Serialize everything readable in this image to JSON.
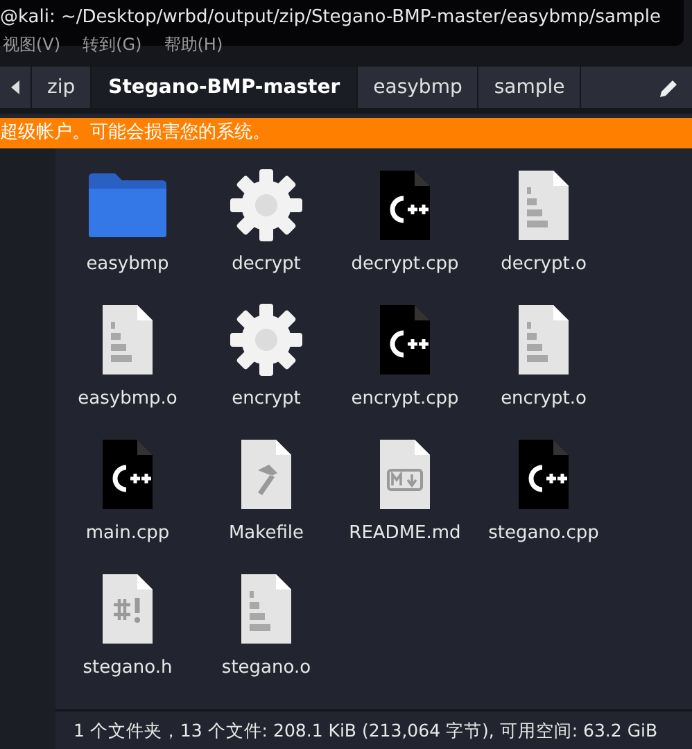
{
  "location": {
    "path": "@kali: ~/Desktop/wrbd/output/zip/Stegano-BMP-master/easybmp/sample"
  },
  "menu": [
    "视图(V)",
    "转到(G)",
    "帮助(H)"
  ],
  "breadcrumbs": [
    {
      "label": "zip",
      "selected": false
    },
    {
      "label": "Stegano-BMP-master",
      "selected": true
    },
    {
      "label": "easybmp",
      "selected": false
    },
    {
      "label": "sample",
      "selected": false
    }
  ],
  "warning": "超级帐户。可能会损害您的系统。",
  "files": [
    {
      "name": "easybmp",
      "kind": "folder"
    },
    {
      "name": "decrypt",
      "kind": "executable"
    },
    {
      "name": "decrypt.cpp",
      "kind": "cpp"
    },
    {
      "name": "decrypt.o",
      "kind": "binary"
    },
    {
      "name": "easybmp.o",
      "kind": "binary"
    },
    {
      "name": "encrypt",
      "kind": "executable"
    },
    {
      "name": "encrypt.cpp",
      "kind": "cpp"
    },
    {
      "name": "encrypt.o",
      "kind": "binary"
    },
    {
      "name": "main.cpp",
      "kind": "cpp"
    },
    {
      "name": "Makefile",
      "kind": "makefile"
    },
    {
      "name": "README.md",
      "kind": "markdown"
    },
    {
      "name": "stegano.cpp",
      "kind": "cpp"
    },
    {
      "name": "stegano.h",
      "kind": "header"
    },
    {
      "name": "stegano.o",
      "kind": "binary"
    }
  ],
  "status_bar": "1 个文件夹，13 个文件: 208.1 KiB (213,064 字节), 可用空间: 63.2 GiB"
}
